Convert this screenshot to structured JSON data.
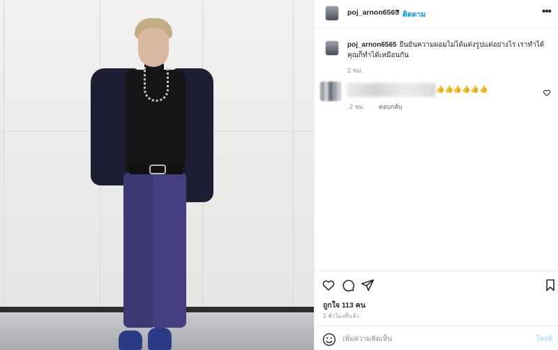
{
  "header": {
    "username": "poj_arnon6565",
    "separator": "•",
    "follow_label": "ติดตาม",
    "more_label": "•••"
  },
  "caption": {
    "username": "poj_arnon6565",
    "text": "ยืนยันความผอมไม่ได้แต่งรูปแต่อย่างไร เราทำได้คุณก็ทำได้เหมือนกัน",
    "time": "2 ชม."
  },
  "comment": {
    "text": "👍👍👍👍👍👍",
    "time": "2 ชม.",
    "reply_label": "ตอบกลับ"
  },
  "actions": {
    "likes_label": "ถูกใจ 113 คน",
    "posted_time": "2 ชั่วโมงที่แล้ว"
  },
  "add_comment": {
    "placeholder": "เพิ่มความคิดเห็น",
    "post_label": "โพสต์"
  },
  "icons": {
    "like": "heart-icon",
    "comment": "speech-bubble-icon",
    "share": "paper-plane-icon",
    "save": "bookmark-icon",
    "emoji": "smiley-icon"
  },
  "colors": {
    "accent": "#0095f6",
    "post_disabled": "#b2dffc",
    "muted": "#8e8e8e"
  }
}
